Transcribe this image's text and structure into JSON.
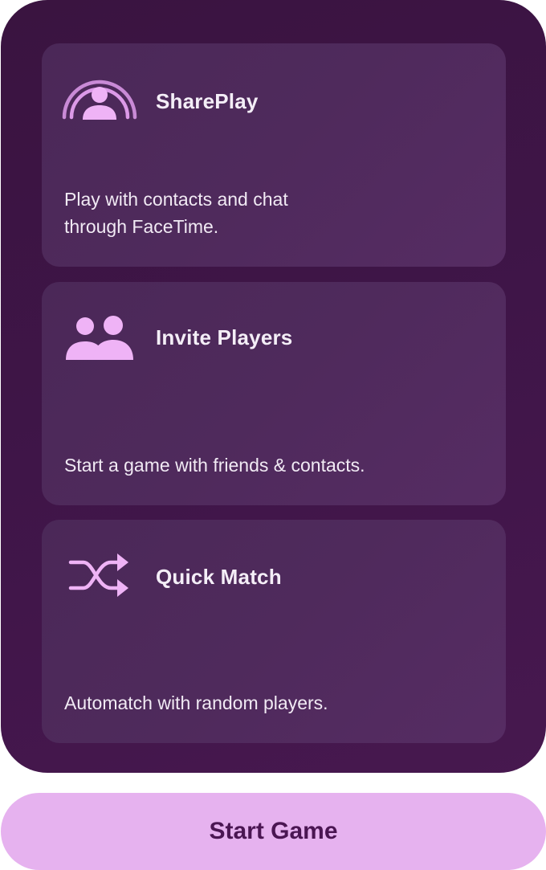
{
  "options": [
    {
      "id": "shareplay",
      "title": "SharePlay",
      "description": "Play with contacts and chat through FaceTime.",
      "icon": "shareplay-icon"
    },
    {
      "id": "invite",
      "title": "Invite Players",
      "description": "Start a game with friends & contacts.",
      "icon": "two-people-icon"
    },
    {
      "id": "quick-match",
      "title": "Quick Match",
      "description": "Automatch with random players.",
      "icon": "shuffle-icon"
    }
  ],
  "start_button": {
    "label": "Start Game"
  },
  "colors": {
    "panel_background": "#3f1548",
    "card_background": "#4f2a5c",
    "accent": "#e6b2ef",
    "icon": "#e9a6f2",
    "button_text": "#4a1652"
  }
}
